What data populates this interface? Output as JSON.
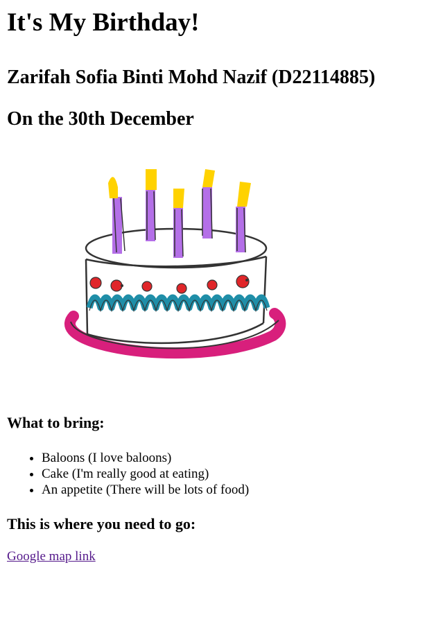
{
  "page": {
    "title": "It's My Birthday!",
    "name_line": "Zarifah Sofia Binti Mohd Nazif (D22114885)",
    "date_line": "On the 30th December"
  },
  "image": {
    "icon": "birthday-cake-icon",
    "colors": {
      "candle": "#b46fe8",
      "flame": "#ffd200",
      "wave": "#1f8ea8",
      "plate": "#d81f7c",
      "dots": "#e0262a"
    }
  },
  "bring": {
    "heading": "What to bring:",
    "items": [
      "Baloons (I love baloons)",
      "Cake (I'm really good at eating)",
      "An appetite (There will be lots of food)"
    ]
  },
  "location": {
    "heading": "This is where you need to go:",
    "link_text": "Google map link"
  }
}
